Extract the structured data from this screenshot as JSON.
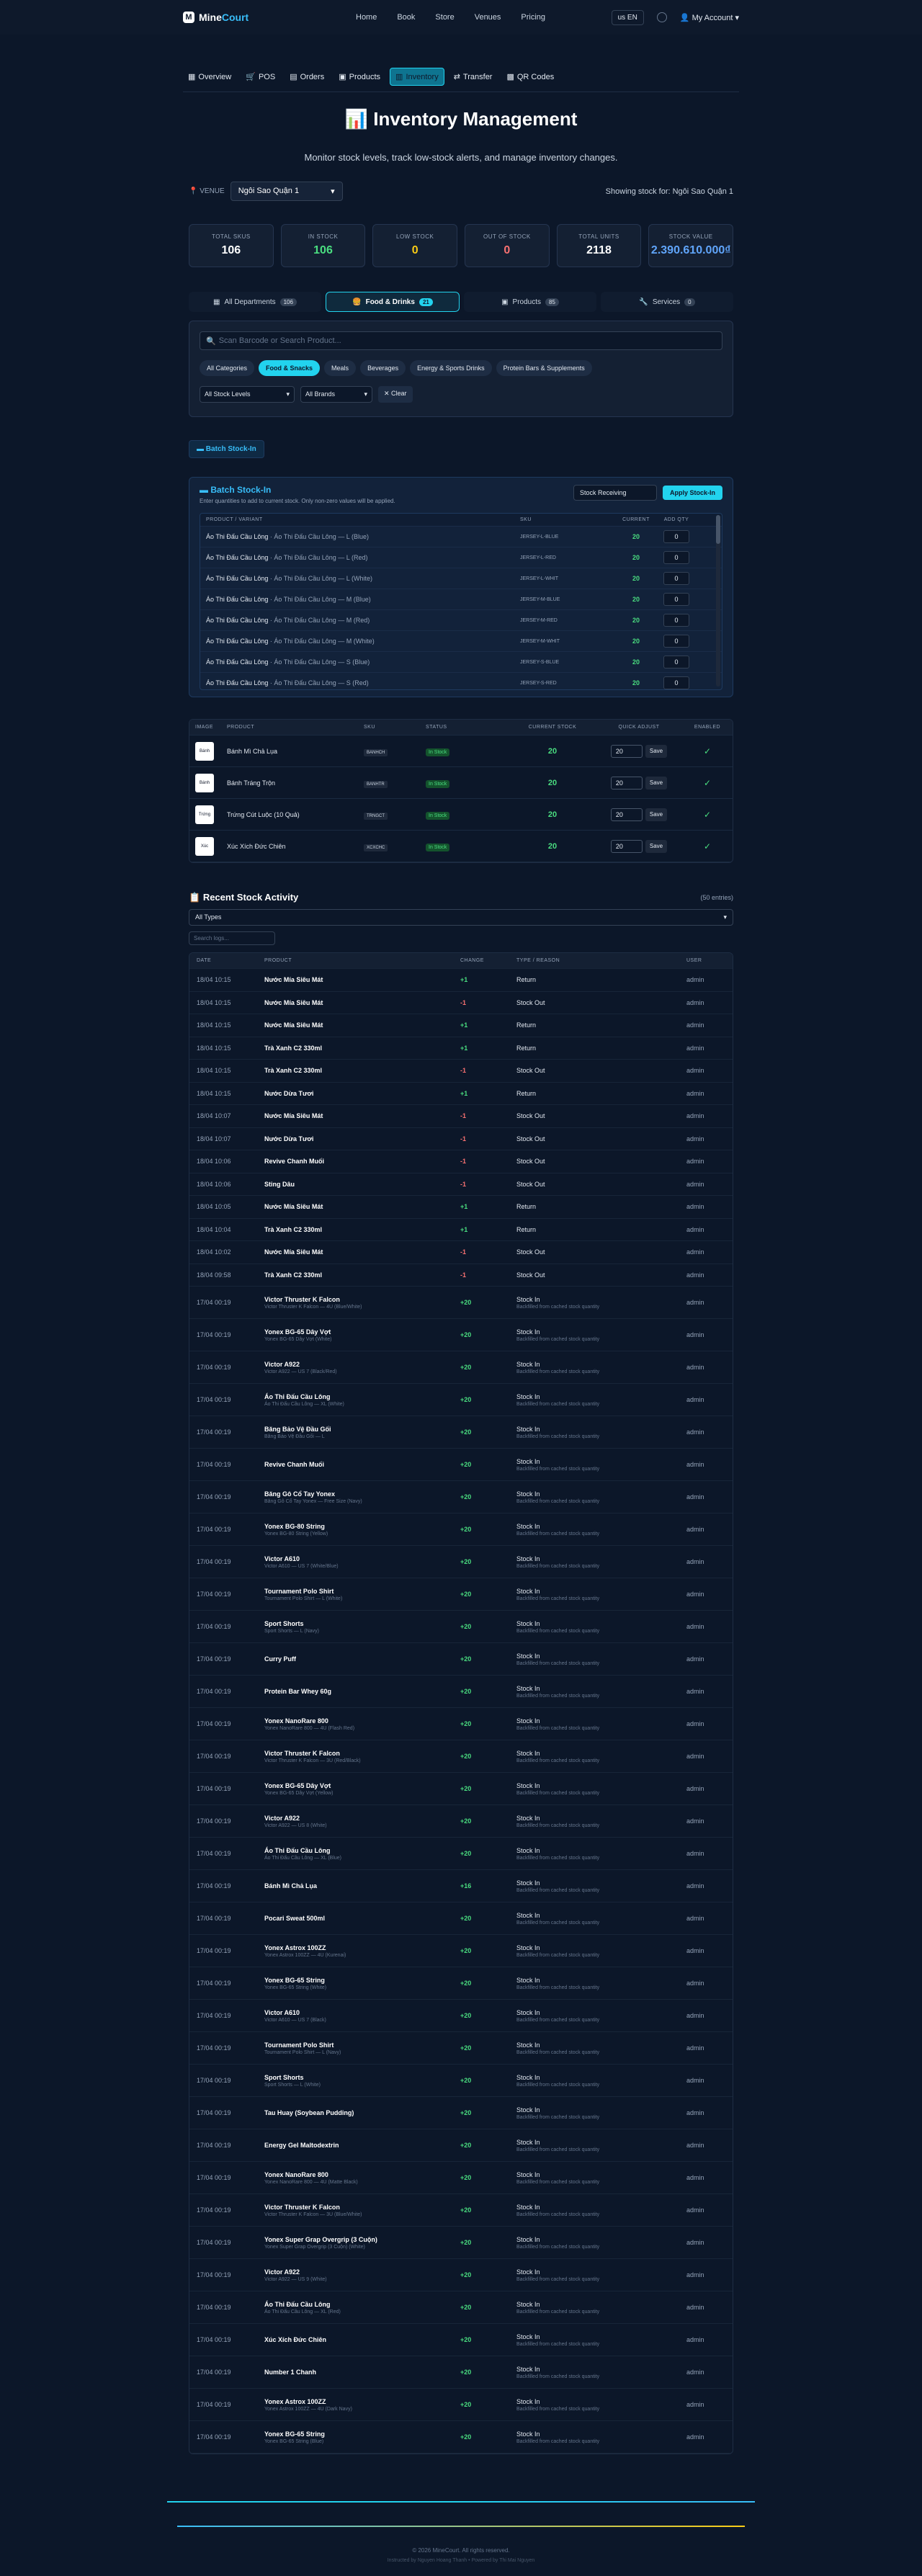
{
  "header": {
    "logo_mark": "M",
    "brand_a": "Mine",
    "brand_b": "Court",
    "nav": [
      "Home",
      "Book",
      "Store",
      "Venues",
      "Pricing"
    ],
    "lang": "us EN",
    "account": "My Account"
  },
  "tabs": [
    "Overview",
    "POS",
    "Orders",
    "Products",
    "Inventory",
    "Transfer",
    "QR Codes"
  ],
  "page": {
    "title": "Inventory Management",
    "subtitle": "Monitor stock levels, track low-stock alerts, and manage inventory changes.",
    "venue_label": "VENUE",
    "venue_value": "Ngôi Sao Quận 1",
    "showing": "Showing stock for: Ngôi Sao Quận 1"
  },
  "stats": [
    {
      "label": "TOTAL SKUS",
      "value": "106",
      "color": "#ffffff"
    },
    {
      "label": "IN STOCK",
      "value": "106",
      "color": "#4ade80"
    },
    {
      "label": "LOW STOCK",
      "value": "0",
      "color": "#facc15"
    },
    {
      "label": "OUT OF STOCK",
      "value": "0",
      "color": "#f87171"
    },
    {
      "label": "TOTAL UNITS",
      "value": "2118",
      "color": "#ffffff"
    },
    {
      "label": "STOCK VALUE",
      "value": "2.390.610.000₫",
      "color": "#60a5fa"
    }
  ],
  "departments": [
    {
      "label": "All Departments",
      "count": "106"
    },
    {
      "label": "Food & Drinks",
      "count": "21"
    },
    {
      "label": "Products",
      "count": "85"
    },
    {
      "label": "Services",
      "count": "0"
    }
  ],
  "filter": {
    "search_placeholder": "Scan Barcode or Search Product...",
    "categories": [
      "All Categories",
      "Food & Snacks",
      "Meals",
      "Beverages",
      "Energy & Sports Drinks",
      "Protein Bars & Supplements"
    ],
    "stock_level": "All Stock Levels",
    "brand": "All Brands",
    "clear": "✕ Clear"
  },
  "batch": {
    "toggle": "Batch Stock-In",
    "title": "Batch Stock-In",
    "subtitle": "Enter quantities to add to current stock. Only non-zero values will be applied.",
    "mode": "Stock Receiving",
    "apply": "Apply Stock-In",
    "headers": [
      "PRODUCT / VARIANT",
      "SKU",
      "CURRENT",
      "ADD QTY"
    ],
    "rows": [
      {
        "name": "Áo Thi Đấu Cầu Lông",
        "variant": " · Áo Thi Đấu Cầu Lông — L (Blue)",
        "sku": "JERSEY-L-BLUE",
        "current": "20",
        "qty": "0"
      },
      {
        "name": "Áo Thi Đấu Cầu Lông",
        "variant": " · Áo Thi Đấu Cầu Lông — L (Red)",
        "sku": "JERSEY-L-RED",
        "current": "20",
        "qty": "0"
      },
      {
        "name": "Áo Thi Đấu Cầu Lông",
        "variant": " · Áo Thi Đấu Cầu Lông — L (White)",
        "sku": "JERSEY-L-WHIT",
        "current": "20",
        "qty": "0"
      },
      {
        "name": "Áo Thi Đấu Cầu Lông",
        "variant": " · Áo Thi Đấu Cầu Lông — M (Blue)",
        "sku": "JERSEY-M-BLUE",
        "current": "20",
        "qty": "0"
      },
      {
        "name": "Áo Thi Đấu Cầu Lông",
        "variant": " · Áo Thi Đấu Cầu Lông — M (Red)",
        "sku": "JERSEY-M-RED",
        "current": "20",
        "qty": "0"
      },
      {
        "name": "Áo Thi Đấu Cầu Lông",
        "variant": " · Áo Thi Đấu Cầu Lông — M (White)",
        "sku": "JERSEY-M-WHIT",
        "current": "20",
        "qty": "0"
      },
      {
        "name": "Áo Thi Đấu Cầu Lông",
        "variant": " · Áo Thi Đấu Cầu Lông — S (Blue)",
        "sku": "JERSEY-S-BLUE",
        "current": "20",
        "qty": "0"
      },
      {
        "name": "Áo Thi Đấu Cầu Lông",
        "variant": " · Áo Thi Đấu Cầu Lông — S (Red)",
        "sku": "JERSEY-S-RED",
        "current": "20",
        "qty": "0"
      }
    ]
  },
  "products": {
    "headers": [
      "IMAGE",
      "PRODUCT",
      "SKU",
      "STATUS",
      "CURRENT STOCK",
      "QUICK ADJUST",
      "ENABLED"
    ],
    "rows": [
      {
        "img": "Bánh",
        "name": "Bánh Mì Chả Lụa",
        "sku": "BANHCH",
        "status": "In Stock",
        "stock": "20",
        "qty": "20",
        "save": "Save"
      },
      {
        "img": "Bánh",
        "name": "Bánh Tráng Trộn",
        "sku": "BANHTR",
        "status": "In Stock",
        "stock": "20",
        "qty": "20",
        "save": "Save"
      },
      {
        "img": "Trứng",
        "name": "Trứng Cút Luộc (10 Quả)",
        "sku": "TRNGCT",
        "status": "In Stock",
        "stock": "20",
        "qty": "20",
        "save": "Save"
      },
      {
        "img": "Xúc",
        "name": "Xúc Xích Đức Chiên",
        "sku": "XCXCHC",
        "status": "In Stock",
        "stock": "20",
        "qty": "20",
        "save": "Save"
      }
    ]
  },
  "activity": {
    "title": "Recent Stock Activity",
    "count": "(50 entries)",
    "type_filter": "All Types",
    "search_placeholder": "Search logs...",
    "headers": [
      "DATE",
      "PRODUCT",
      "CHANGE",
      "TYPE / REASON",
      "USER"
    ],
    "rows": [
      {
        "date": "18/04 10:15",
        "product": "Nước Mía Siêu Mát",
        "variant": "",
        "change": "+1",
        "type": "Return",
        "reason": "",
        "user": "admin"
      },
      {
        "date": "18/04 10:15",
        "product": "Nước Mía Siêu Mát",
        "variant": "",
        "change": "-1",
        "type": "Stock Out",
        "reason": "",
        "user": "admin"
      },
      {
        "date": "18/04 10:15",
        "product": "Nước Mía Siêu Mát",
        "variant": "",
        "change": "+1",
        "type": "Return",
        "reason": "",
        "user": "admin"
      },
      {
        "date": "18/04 10:15",
        "product": "Trà Xanh C2 330ml",
        "variant": "",
        "change": "+1",
        "type": "Return",
        "reason": "",
        "user": "admin"
      },
      {
        "date": "18/04 10:15",
        "product": "Trà Xanh C2 330ml",
        "variant": "",
        "change": "-1",
        "type": "Stock Out",
        "reason": "",
        "user": "admin"
      },
      {
        "date": "18/04 10:15",
        "product": "Nước Dừa Tươi",
        "variant": "",
        "change": "+1",
        "type": "Return",
        "reason": "",
        "user": "admin"
      },
      {
        "date": "18/04 10:07",
        "product": "Nước Mía Siêu Mát",
        "variant": "",
        "change": "-1",
        "type": "Stock Out",
        "reason": "",
        "user": "admin"
      },
      {
        "date": "18/04 10:07",
        "product": "Nước Dừa Tươi",
        "variant": "",
        "change": "-1",
        "type": "Stock Out",
        "reason": "",
        "user": "admin"
      },
      {
        "date": "18/04 10:06",
        "product": "Revive Chanh Muối",
        "variant": "",
        "change": "-1",
        "type": "Stock Out",
        "reason": "",
        "user": "admin"
      },
      {
        "date": "18/04 10:06",
        "product": "Sting Dâu",
        "variant": "",
        "change": "-1",
        "type": "Stock Out",
        "reason": "",
        "user": "admin"
      },
      {
        "date": "18/04 10:05",
        "product": "Nước Mía Siêu Mát",
        "variant": "",
        "change": "+1",
        "type": "Return",
        "reason": "",
        "user": "admin"
      },
      {
        "date": "18/04 10:04",
        "product": "Trà Xanh C2 330ml",
        "variant": "",
        "change": "+1",
        "type": "Return",
        "reason": "",
        "user": "admin"
      },
      {
        "date": "18/04 10:02",
        "product": "Nước Mía Siêu Mát",
        "variant": "",
        "change": "-1",
        "type": "Stock Out",
        "reason": "",
        "user": "admin"
      },
      {
        "date": "18/04 09:58",
        "product": "Trà Xanh C2 330ml",
        "variant": "",
        "change": "-1",
        "type": "Stock Out",
        "reason": "",
        "user": "admin"
      },
      {
        "date": "17/04 00:19",
        "product": "Victor Thruster K Falcon",
        "variant": "Victor Thruster K Falcon — 4U (Blue/White)",
        "change": "+20",
        "type": "Stock In",
        "reason": "Backfilled from cached stock quantity",
        "user": "admin"
      },
      {
        "date": "17/04 00:19",
        "product": "Yonex BG-65 Dây Vợt",
        "variant": "Yonex BG-65 Dây Vợt (White)",
        "change": "+20",
        "type": "Stock In",
        "reason": "Backfilled from cached stock quantity",
        "user": "admin"
      },
      {
        "date": "17/04 00:19",
        "product": "Victor A922",
        "variant": "Victor A922 — US 7 (Black/Red)",
        "change": "+20",
        "type": "Stock In",
        "reason": "Backfilled from cached stock quantity",
        "user": "admin"
      },
      {
        "date": "17/04 00:19",
        "product": "Áo Thi Đấu Cầu Lông",
        "variant": "Áo Thi Đấu Cầu Lông — XL (White)",
        "change": "+20",
        "type": "Stock In",
        "reason": "Backfilled from cached stock quantity",
        "user": "admin"
      },
      {
        "date": "17/04 00:19",
        "product": "Băng Bảo Vệ Đầu Gối",
        "variant": "Băng Bảo Vệ Đầu Gối — L",
        "change": "+20",
        "type": "Stock In",
        "reason": "Backfilled from cached stock quantity",
        "user": "admin"
      },
      {
        "date": "17/04 00:19",
        "product": "Revive Chanh Muối",
        "variant": "",
        "change": "+20",
        "type": "Stock In",
        "reason": "Backfilled from cached stock quantity",
        "user": "admin"
      },
      {
        "date": "17/04 00:19",
        "product": "Băng Gô Cổ Tay Yonex",
        "variant": "Băng Gô Cổ Tay Yonex — Free Size (Navy)",
        "change": "+20",
        "type": "Stock In",
        "reason": "Backfilled from cached stock quantity",
        "user": "admin"
      },
      {
        "date": "17/04 00:19",
        "product": "Yonex BG-80 String",
        "variant": "Yonex BG-80 String (Yellow)",
        "change": "+20",
        "type": "Stock In",
        "reason": "Backfilled from cached stock quantity",
        "user": "admin"
      },
      {
        "date": "17/04 00:19",
        "product": "Victor A610",
        "variant": "Victor A610 — US 7 (White/Blue)",
        "change": "+20",
        "type": "Stock In",
        "reason": "Backfilled from cached stock quantity",
        "user": "admin"
      },
      {
        "date": "17/04 00:19",
        "product": "Tournament Polo Shirt",
        "variant": "Tournament Polo Shirt — L (White)",
        "change": "+20",
        "type": "Stock In",
        "reason": "Backfilled from cached stock quantity",
        "user": "admin"
      },
      {
        "date": "17/04 00:19",
        "product": "Sport Shorts",
        "variant": "Sport Shorts — L (Navy)",
        "change": "+20",
        "type": "Stock In",
        "reason": "Backfilled from cached stock quantity",
        "user": "admin"
      },
      {
        "date": "17/04 00:19",
        "product": "Curry Puff",
        "variant": "",
        "change": "+20",
        "type": "Stock In",
        "reason": "Backfilled from cached stock quantity",
        "user": "admin"
      },
      {
        "date": "17/04 00:19",
        "product": "Protein Bar Whey 60g",
        "variant": "",
        "change": "+20",
        "type": "Stock In",
        "reason": "Backfilled from cached stock quantity",
        "user": "admin"
      },
      {
        "date": "17/04 00:19",
        "product": "Yonex NanoRare 800",
        "variant": "Yonex NanoRare 800 — 4U (Flash Red)",
        "change": "+20",
        "type": "Stock In",
        "reason": "Backfilled from cached stock quantity",
        "user": "admin"
      },
      {
        "date": "17/04 00:19",
        "product": "Victor Thruster K Falcon",
        "variant": "Victor Thruster K Falcon — 3U (Red/Black)",
        "change": "+20",
        "type": "Stock In",
        "reason": "Backfilled from cached stock quantity",
        "user": "admin"
      },
      {
        "date": "17/04 00:19",
        "product": "Yonex BG-65 Dây Vợt",
        "variant": "Yonex BG-65 Dây Vợt (Yellow)",
        "change": "+20",
        "type": "Stock In",
        "reason": "Backfilled from cached stock quantity",
        "user": "admin"
      },
      {
        "date": "17/04 00:19",
        "product": "Victor A922",
        "variant": "Victor A922 — US 8 (White)",
        "change": "+20",
        "type": "Stock In",
        "reason": "Backfilled from cached stock quantity",
        "user": "admin"
      },
      {
        "date": "17/04 00:19",
        "product": "Áo Thi Đấu Cầu Lông",
        "variant": "Áo Thi Đấu Cầu Lông — XL (Blue)",
        "change": "+20",
        "type": "Stock In",
        "reason": "Backfilled from cached stock quantity",
        "user": "admin"
      },
      {
        "date": "17/04 00:19",
        "product": "Bánh Mì Chả Lụa",
        "variant": "",
        "change": "+16",
        "type": "Stock In",
        "reason": "Backfilled from cached stock quantity",
        "user": "admin"
      },
      {
        "date": "17/04 00:19",
        "product": "Pocari Sweat 500ml",
        "variant": "",
        "change": "+20",
        "type": "Stock In",
        "reason": "Backfilled from cached stock quantity",
        "user": "admin"
      },
      {
        "date": "17/04 00:19",
        "product": "Yonex Astrox 100ZZ",
        "variant": "Yonex Astrox 100ZZ — 4U (Kurenai)",
        "change": "+20",
        "type": "Stock In",
        "reason": "Backfilled from cached stock quantity",
        "user": "admin"
      },
      {
        "date": "17/04 00:19",
        "product": "Yonex BG-65 String",
        "variant": "Yonex BG-65 String (White)",
        "change": "+20",
        "type": "Stock In",
        "reason": "Backfilled from cached stock quantity",
        "user": "admin"
      },
      {
        "date": "17/04 00:19",
        "product": "Victor A610",
        "variant": "Victor A610 — US 7 (Black)",
        "change": "+20",
        "type": "Stock In",
        "reason": "Backfilled from cached stock quantity",
        "user": "admin"
      },
      {
        "date": "17/04 00:19",
        "product": "Tournament Polo Shirt",
        "variant": "Tournament Polo Shirt — L (Navy)",
        "change": "+20",
        "type": "Stock In",
        "reason": "Backfilled from cached stock quantity",
        "user": "admin"
      },
      {
        "date": "17/04 00:19",
        "product": "Sport Shorts",
        "variant": "Sport Shorts — L (White)",
        "change": "+20",
        "type": "Stock In",
        "reason": "Backfilled from cached stock quantity",
        "user": "admin"
      },
      {
        "date": "17/04 00:19",
        "product": "Tau Huay (Soybean Pudding)",
        "variant": "",
        "change": "+20",
        "type": "Stock In",
        "reason": "Backfilled from cached stock quantity",
        "user": "admin"
      },
      {
        "date": "17/04 00:19",
        "product": "Energy Gel Maltodextrin",
        "variant": "",
        "change": "+20",
        "type": "Stock In",
        "reason": "Backfilled from cached stock quantity",
        "user": "admin"
      },
      {
        "date": "17/04 00:19",
        "product": "Yonex NanoRare 800",
        "variant": "Yonex NanoRare 800 — 4U (Matte Black)",
        "change": "+20",
        "type": "Stock In",
        "reason": "Backfilled from cached stock quantity",
        "user": "admin"
      },
      {
        "date": "17/04 00:19",
        "product": "Victor Thruster K Falcon",
        "variant": "Victor Thruster K Falcon — 3U (Blue/White)",
        "change": "+20",
        "type": "Stock In",
        "reason": "Backfilled from cached stock quantity",
        "user": "admin"
      },
      {
        "date": "17/04 00:19",
        "product": "Yonex Super Grap Overgrip (3 Cuộn)",
        "variant": "Yonex Super Grap Overgrip (3 Cuộn) (White)",
        "change": "+20",
        "type": "Stock In",
        "reason": "Backfilled from cached stock quantity",
        "user": "admin"
      },
      {
        "date": "17/04 00:19",
        "product": "Victor A922",
        "variant": "Victor A922 — US 9 (White)",
        "change": "+20",
        "type": "Stock In",
        "reason": "Backfilled from cached stock quantity",
        "user": "admin"
      },
      {
        "date": "17/04 00:19",
        "product": "Áo Thi Đấu Cầu Lông",
        "variant": "Áo Thi Đấu Cầu Lông — XL (Red)",
        "change": "+20",
        "type": "Stock In",
        "reason": "Backfilled from cached stock quantity",
        "user": "admin"
      },
      {
        "date": "17/04 00:19",
        "product": "Xúc Xích Đức Chiên",
        "variant": "",
        "change": "+20",
        "type": "Stock In",
        "reason": "Backfilled from cached stock quantity",
        "user": "admin"
      },
      {
        "date": "17/04 00:19",
        "product": "Number 1 Chanh",
        "variant": "",
        "change": "+20",
        "type": "Stock In",
        "reason": "Backfilled from cached stock quantity",
        "user": "admin"
      },
      {
        "date": "17/04 00:19",
        "product": "Yonex Astrox 100ZZ",
        "variant": "Yonex Astrox 100ZZ — 4U (Dark Navy)",
        "change": "+20",
        "type": "Stock In",
        "reason": "Backfilled from cached stock quantity",
        "user": "admin"
      },
      {
        "date": "17/04 00:19",
        "product": "Yonex BG-65 String",
        "variant": "Yonex BG-65 String (Blue)",
        "change": "+20",
        "type": "Stock In",
        "reason": "Backfilled from cached stock quantity",
        "user": "admin"
      }
    ]
  },
  "footer": {
    "copyright": "© 2026 MineCourt. All rights reserved.",
    "credit": "Instructed by Nguyen Hoang Thanh • Powered by Thi Mai Nguyen"
  }
}
